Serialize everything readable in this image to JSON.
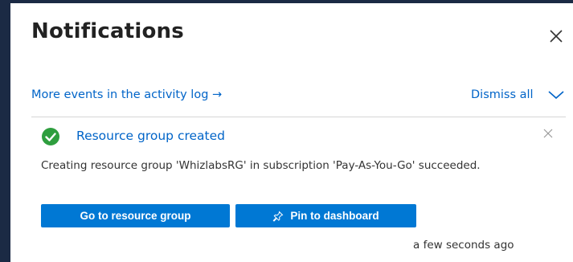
{
  "panel": {
    "title": "Notifications",
    "close_icon": "close-icon"
  },
  "toolbar": {
    "activity_link_label": "More events in the activity log →",
    "dismiss_all_label": "Dismiss all",
    "collapse_icon": "chevron-down-icon"
  },
  "notification": {
    "status_icon": "success-check-icon",
    "status_color": "#2e9e3e",
    "title": "Resource group created",
    "message": "Creating resource group 'WhizlabsRG' in subscription 'Pay-As-You-Go' succeeded.",
    "primary_button_label": "Go to resource group",
    "secondary_button_label": "Pin to dashboard",
    "secondary_button_icon": "pin-icon",
    "timestamp": "a few seconds ago",
    "dismiss_icon": "close-icon"
  },
  "colors": {
    "accent": "#0078d4",
    "link": "#0064c8",
    "sidebar_edge": "#1b2a44"
  }
}
